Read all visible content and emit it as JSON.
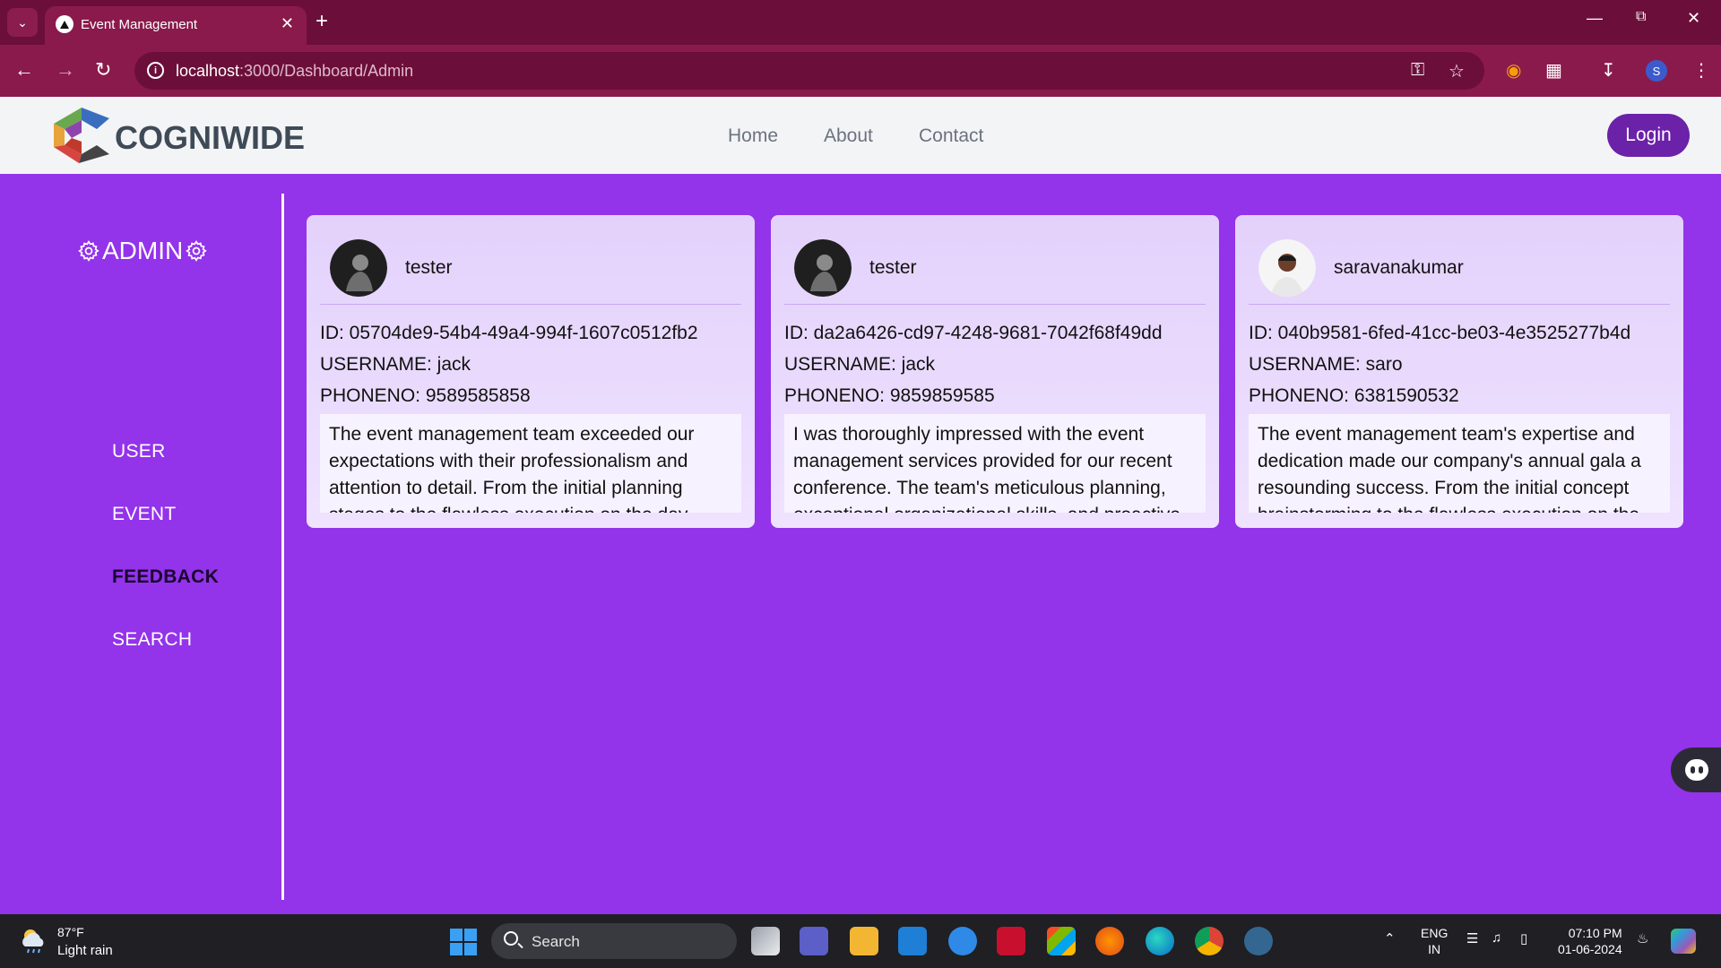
{
  "browser": {
    "tab_title": "Event Management",
    "url_host": "localhost",
    "url_rest": ":3000/Dashboard/Admin"
  },
  "header": {
    "brand": "COGNIWIDE",
    "nav": [
      "Home",
      "About",
      "Contact"
    ],
    "login_label": "Login"
  },
  "sidebar": {
    "title": "ADMIN",
    "items": [
      {
        "label": "USER",
        "active": false
      },
      {
        "label": "EVENT",
        "active": false
      },
      {
        "label": "FEEDBACK",
        "active": true
      },
      {
        "label": "SEARCH",
        "active": false
      }
    ]
  },
  "cards": [
    {
      "name": "tester",
      "id": "ID: 05704de9-54b4-49a4-994f-1607c0512fb2",
      "username": "USERNAME: jack",
      "phone": "PHONENO: 9589585858",
      "feedback": "The event management team exceeded our expectations with their professionalism and attention to detail. From the initial planning stages to the flawless execution on the day"
    },
    {
      "name": "tester",
      "id": "ID: da2a6426-cd97-4248-9681-7042f68f49dd",
      "username": "USERNAME: jack",
      "phone": "PHONENO: 9859859585",
      "feedback": "I was thoroughly impressed with the event management services provided for our recent conference. The team's meticulous planning, exceptional organizational skills, and proactive"
    },
    {
      "name": "saravanakumar",
      "id": "ID: 040b9581-6fed-41cc-be03-4e3525277b4d",
      "username": "USERNAME: saro",
      "phone": "PHONENO: 6381590532",
      "feedback": "The event management team's expertise and dedication made our company's annual gala a resounding success. From the initial concept brainstorming to the flawless execution on the"
    }
  ],
  "taskbar": {
    "temp": "87°F",
    "condition": "Light rain",
    "search_label": "Search",
    "lang_line1": "ENG",
    "lang_line2": "IN",
    "time": "07:10 PM",
    "date": "01-06-2024"
  }
}
